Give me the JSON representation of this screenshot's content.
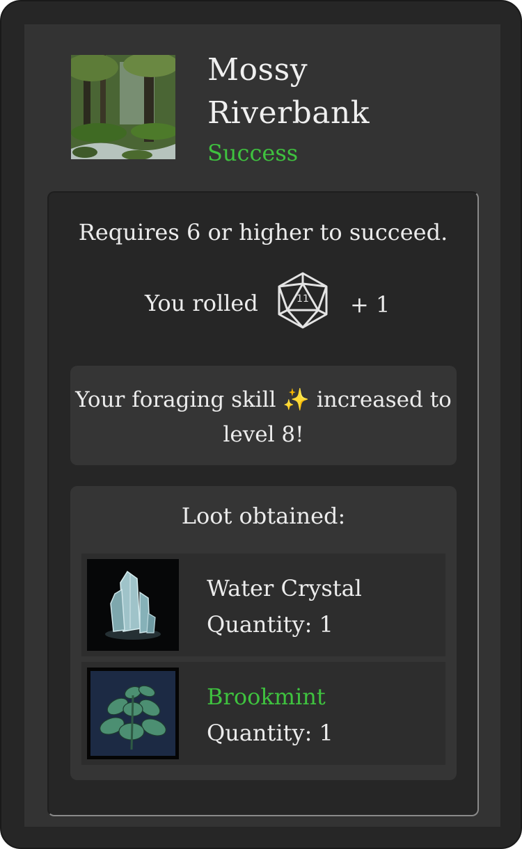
{
  "location": {
    "title": "Mossy Riverbank",
    "status": "Success",
    "thumbnail_icon": "forest-stream-image",
    "status_color": "#3fc23f"
  },
  "roll": {
    "requirement_text": "Requires 6 or higher to succeed.",
    "rolled_label": "You rolled",
    "die_icon": "d20-icon",
    "die_value": "11",
    "modifier": "+ 1"
  },
  "skill": {
    "text_before": "Your foraging skill",
    "sparkle_icon": "✨",
    "text_after": "increased to level 8!"
  },
  "loot": {
    "title": "Loot obtained:",
    "items": [
      {
        "name": "Water Crystal",
        "quantity_label": "Quantity:",
        "quantity": "1",
        "icon": "water-crystal-icon",
        "name_color": "#ececec"
      },
      {
        "name": "Brookmint",
        "quantity_label": "Quantity:",
        "quantity": "1",
        "icon": "brookmint-icon",
        "name_color": "#3fc23f"
      }
    ]
  }
}
